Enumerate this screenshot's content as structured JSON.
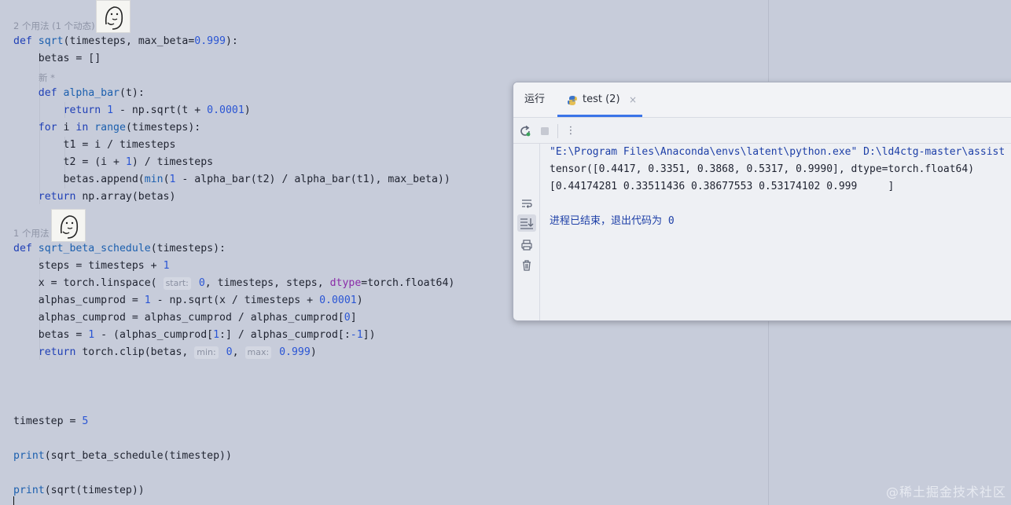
{
  "editor": {
    "annotations": {
      "sqrt_usage": "2 个用法 (1 个动态)",
      "new_marker": "新 *",
      "sched_usage": "1 个用法"
    },
    "code": {
      "l1_def": "def",
      "l1_name": "sqrt",
      "l1_rest": "(timesteps, max_beta=",
      "l1_num": "0.999",
      "l1_end": "):",
      "l2": "    betas = []",
      "l3_def": "    def",
      "l3_name": "alpha_bar",
      "l3_end": "(t):",
      "l4_kw": "        return",
      "l4_a": " 1",
      "l4_b": " - np.sqrt(t + ",
      "l4_num": "0.0001",
      "l4_end": ")",
      "l5_for": "    for",
      "l5_a": " i ",
      "l5_in": "in",
      "l5_range": " range",
      "l5_end": "(timesteps):",
      "l6": "        t1 = i / timesteps",
      "l7_a": "        t2 = (i + ",
      "l7_num": "1",
      "l7_end": ") / timesteps",
      "l8_a": "        betas.append(",
      "l8_min": "min",
      "l8_b": "(",
      "l8_num": "1",
      "l8_end": " - alpha_bar(t2) / alpha_bar(t1), max_beta))",
      "l9_kw": "    return",
      "l9_end": " np.array(betas)",
      "s1_def": "def",
      "s1_name": "sqrt_beta_schedule",
      "s1_end": "(timesteps):",
      "s2_a": "    steps = timesteps + ",
      "s2_num": "1",
      "s3_a": "    x = torch.linspace( ",
      "s3_hint_start": "start:",
      "s3_num0": " 0",
      "s3_b": ", timesteps, steps, ",
      "s3_dtype": "dtype",
      "s3_end": "=torch.float64)",
      "s4_a": "    alphas_cumprod = ",
      "s4_num1": "1",
      "s4_b": " - np.sqrt(x / timesteps + ",
      "s4_num2": "0.0001",
      "s4_end": ")",
      "s5_a": "    alphas_cumprod = alphas_cumprod / alphas_cumprod[",
      "s5_num": "0",
      "s5_end": "]",
      "s6_a": "    betas = ",
      "s6_num1": "1",
      "s6_b": " - (alphas_cumprod[",
      "s6_num2": "1",
      "s6_c": ":] / alphas_cumprod[:",
      "s6_num3": "-1",
      "s6_end": "])",
      "s7_kw": "    return",
      "s7_a": " torch.clip(betas, ",
      "s7_hint_min": "min:",
      "s7_num0": " 0",
      "s7_b": ", ",
      "s7_hint_max": "max:",
      "s7_num1": " 0.999",
      "s7_end": ")",
      "t1_a": "timestep = ",
      "t1_num": "5",
      "t2_print": "print",
      "t2_end": "(sqrt_beta_schedule(timestep))",
      "t3_print": "print",
      "t3_end": "(sqrt(timestep))"
    }
  },
  "run_panel": {
    "tab_run": "运行",
    "tab_test": "test (2)",
    "tab_close": "×",
    "console": {
      "line1": "\"E:\\Program Files\\Anaconda\\envs\\latent\\python.exe\" D:\\ld4ctg-master\\assist",
      "line2": "tensor([0.4417, 0.3351, 0.3868, 0.5317, 0.9990], dtype=torch.float64)",
      "line3": "[0.44174281 0.33511436 0.38677553 0.53174102 0.999     ]",
      "line4": "进程已结束，退出代码为 0"
    }
  },
  "watermark": "@稀土掘金技术社区",
  "colors": {
    "editor_bg": "#c7ccda",
    "keyword": "#1f3fb6",
    "number": "#2a55d4",
    "accent": "#3b74e8"
  }
}
